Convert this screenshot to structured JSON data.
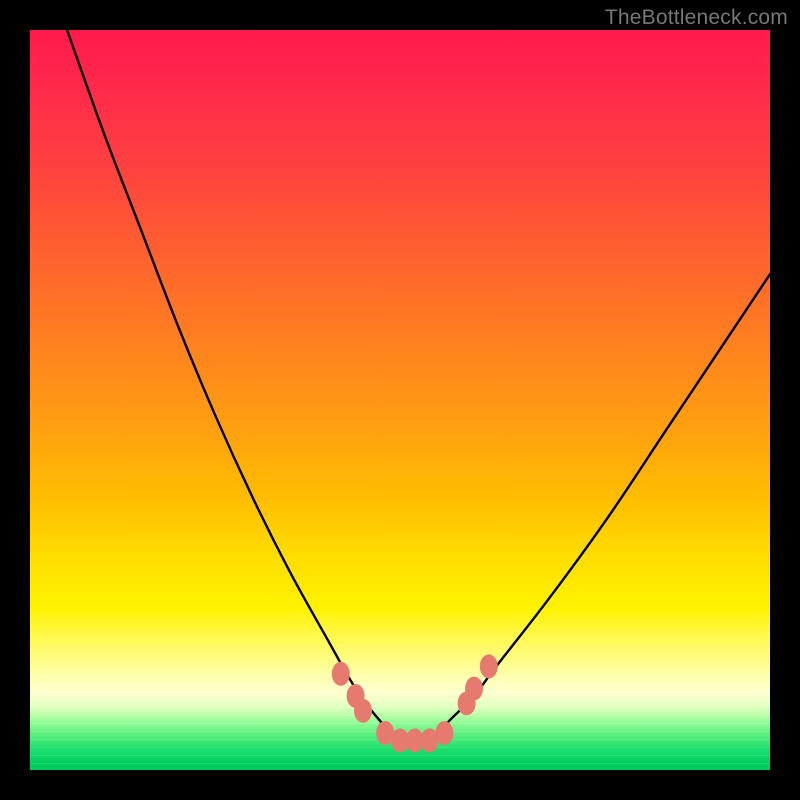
{
  "watermark": "TheBottleneck.com",
  "chart_data": {
    "type": "line",
    "title": "",
    "xlabel": "",
    "ylabel": "",
    "xlim": [
      0,
      100
    ],
    "ylim": [
      0,
      100
    ],
    "legend": false,
    "grid": false,
    "background_gradient": [
      "#ff1a4d",
      "#ff8020",
      "#ffe000",
      "#ffffd0",
      "#00c858"
    ],
    "series": [
      {
        "name": "bottleneck-curve",
        "stroke": "#000000",
        "x": [
          5,
          10,
          15,
          20,
          25,
          30,
          35,
          40,
          44,
          47,
          49,
          51,
          53,
          55,
          57,
          60,
          63,
          70,
          78,
          86,
          94,
          100
        ],
        "y": [
          100,
          86,
          73,
          60,
          48,
          37,
          27,
          18,
          11,
          7,
          5,
          4,
          4,
          5,
          7,
          10,
          14,
          23,
          34,
          46,
          58,
          67
        ]
      }
    ],
    "markers": [
      {
        "name": "curve-point",
        "x": 42,
        "y": 13,
        "color": "#e77a6f"
      },
      {
        "name": "curve-point",
        "x": 44,
        "y": 10,
        "color": "#e77a6f"
      },
      {
        "name": "curve-point",
        "x": 45,
        "y": 8,
        "color": "#e77a6f"
      },
      {
        "name": "curve-point",
        "x": 48,
        "y": 5,
        "color": "#e77a6f"
      },
      {
        "name": "curve-point",
        "x": 50,
        "y": 4,
        "color": "#e77a6f"
      },
      {
        "name": "curve-point",
        "x": 52,
        "y": 4,
        "color": "#e77a6f"
      },
      {
        "name": "curve-point",
        "x": 54,
        "y": 4,
        "color": "#e77a6f"
      },
      {
        "name": "curve-point",
        "x": 56,
        "y": 5,
        "color": "#e77a6f"
      },
      {
        "name": "curve-point",
        "x": 59,
        "y": 9,
        "color": "#e77a6f"
      },
      {
        "name": "curve-point",
        "x": 60,
        "y": 11,
        "color": "#e77a6f"
      },
      {
        "name": "curve-point",
        "x": 62,
        "y": 14,
        "color": "#e77a6f"
      }
    ]
  }
}
